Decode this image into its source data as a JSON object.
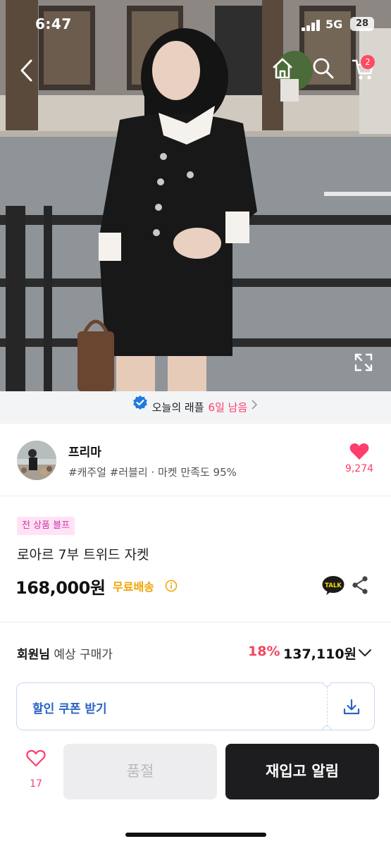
{
  "status_bar": {
    "time": "6:47",
    "network": "5G",
    "battery": "28"
  },
  "nav": {
    "cart_count": "2"
  },
  "raffle": {
    "text": "오늘의 래플",
    "days_left": "6일 남음"
  },
  "store": {
    "name": "프리마",
    "tags": "#캐주얼 #러블리 · 마켓 만족도 95%",
    "likes": "9,274"
  },
  "product": {
    "badge": "전 상품 블프",
    "title": "로아르 7부 트위드 자켓",
    "price": "168,000원",
    "shipping": "무료배송"
  },
  "member_price": {
    "label_bold": "회원님",
    "label_rest": " 예상 구매가",
    "discount": "18%",
    "price": "137,110원"
  },
  "coupon": {
    "label": "할인 쿠폰 받기"
  },
  "bottom_bar": {
    "favorite_count": "17",
    "soldout_label": "품절",
    "restock_label": "재입고 알림"
  },
  "colors": {
    "accent_pink": "#ff3d6b",
    "coupon_blue": "#2b63c5",
    "shipping_orange": "#f0a400",
    "badge_bg": "#ffe3f4",
    "badge_text": "#d233a8"
  },
  "icons": [
    "back-icon",
    "home-icon",
    "search-icon",
    "cart-icon",
    "expand-icon",
    "verified-check-icon",
    "chevron-right-icon",
    "heart-icon",
    "info-icon",
    "kakao-talk-icon",
    "share-icon",
    "chevron-down-icon",
    "download-icon"
  ]
}
